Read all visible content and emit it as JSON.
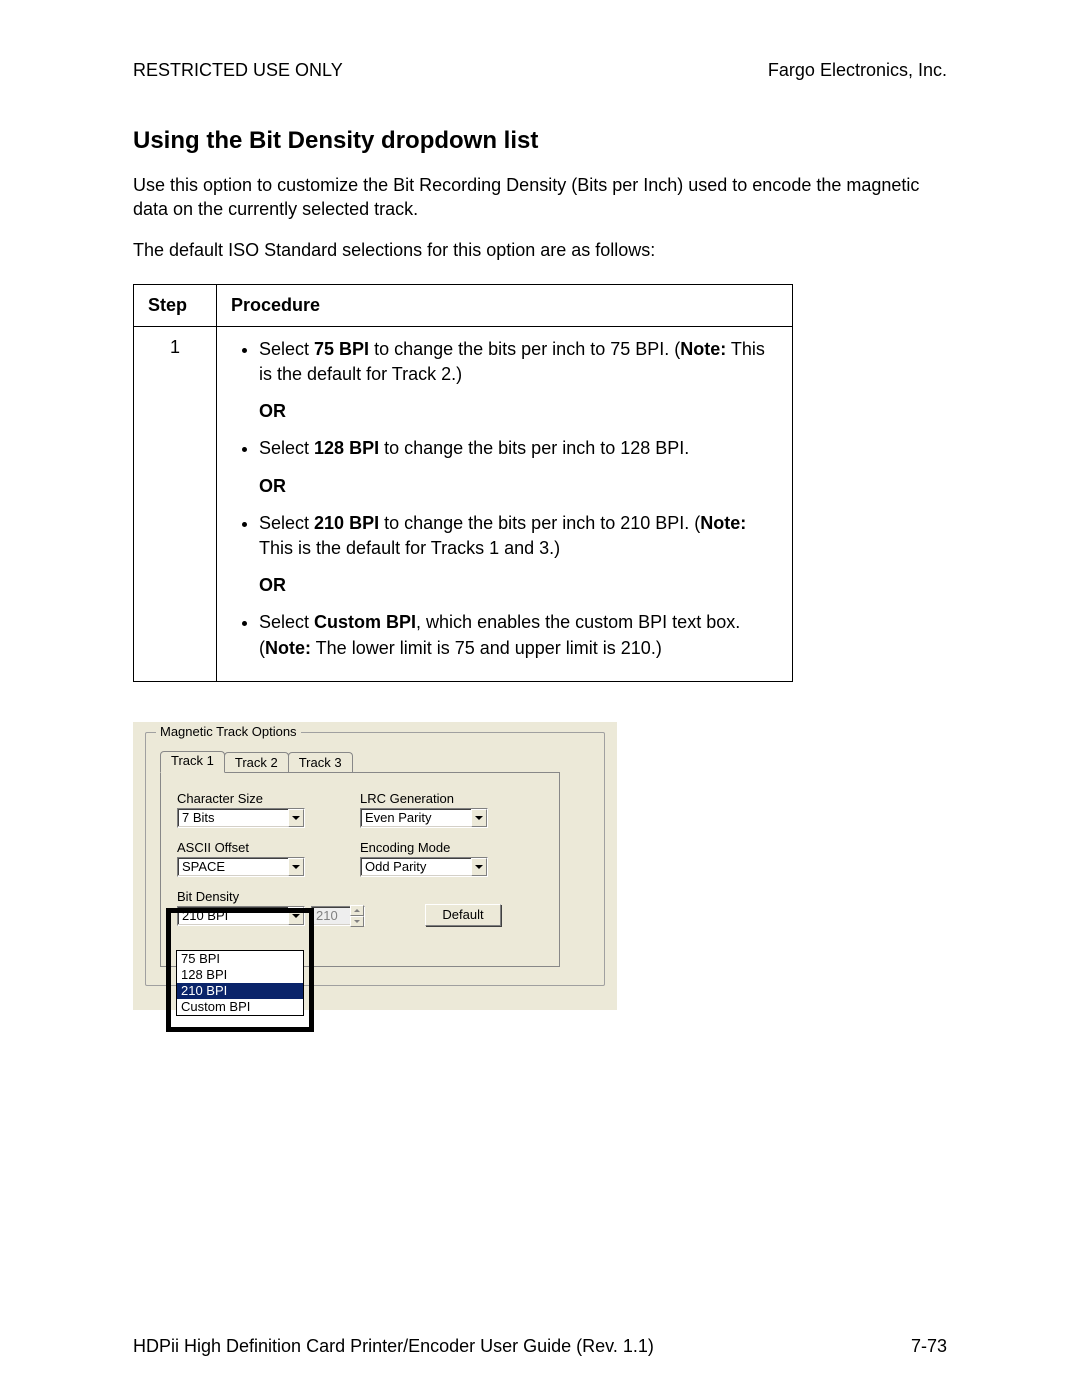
{
  "header": {
    "left": "RESTRICTED USE ONLY",
    "right": "Fargo Electronics, Inc."
  },
  "title": "Using the Bit Density dropdown list",
  "para1": "Use this option to customize the Bit Recording Density (Bits per Inch) used to encode the magnetic data on the currently selected track.",
  "para2": "The default ISO Standard selections for this option are as follows:",
  "table": {
    "head_step": "Step",
    "head_proc": "Procedure",
    "step1": "1",
    "b1_pre": "Select ",
    "b1_bold": "75 BPI",
    "b1_mid": " to change the bits per inch to 75 BPI. (",
    "b1_note": "Note:",
    "b1_post": "  This is the default for Track 2.)",
    "or": "OR",
    "b2_pre": "Select ",
    "b2_bold": "128 BPI",
    "b2_post": " to change the bits per inch to 128 BPI.",
    "b3_pre": "Select ",
    "b3_bold": "210 BPI",
    "b3_mid": " to change the bits per inch to 210 BPI. (",
    "b3_note": "Note:",
    "b3_post": "  This is the default for Tracks 1 and 3.)",
    "b4_pre": "Select ",
    "b4_bold": "Custom BPI",
    "b4_mid": ", which enables the custom BPI text box. (",
    "b4_note": "Note:",
    "b4_post": "  The lower limit is 75 and upper limit is 210.)"
  },
  "ui": {
    "group_title": "Magnetic Track Options",
    "tabs": {
      "t1": "Track 1",
      "t2": "Track 2",
      "t3": "Track 3"
    },
    "char_size_label": "Character Size",
    "char_size_value": "7 Bits",
    "ascii_label": "ASCII Offset",
    "ascii_value": "SPACE",
    "lrc_label": "LRC Generation",
    "lrc_value": "Even Parity",
    "enc_label": "Encoding Mode",
    "enc_value": "Odd Parity",
    "bd_label": "Bit Density",
    "bd_value": "210 BPI",
    "bd_spinner": "210",
    "default_btn": "Default",
    "bd_opt1": "75 BPI",
    "bd_opt2": "128 BPI",
    "bd_opt3": "210 BPI",
    "bd_opt4": "Custom BPI"
  },
  "footer": {
    "left": "HDPii High Definition Card Printer/Encoder User Guide (Rev. 1.1)",
    "right": "7-73"
  }
}
